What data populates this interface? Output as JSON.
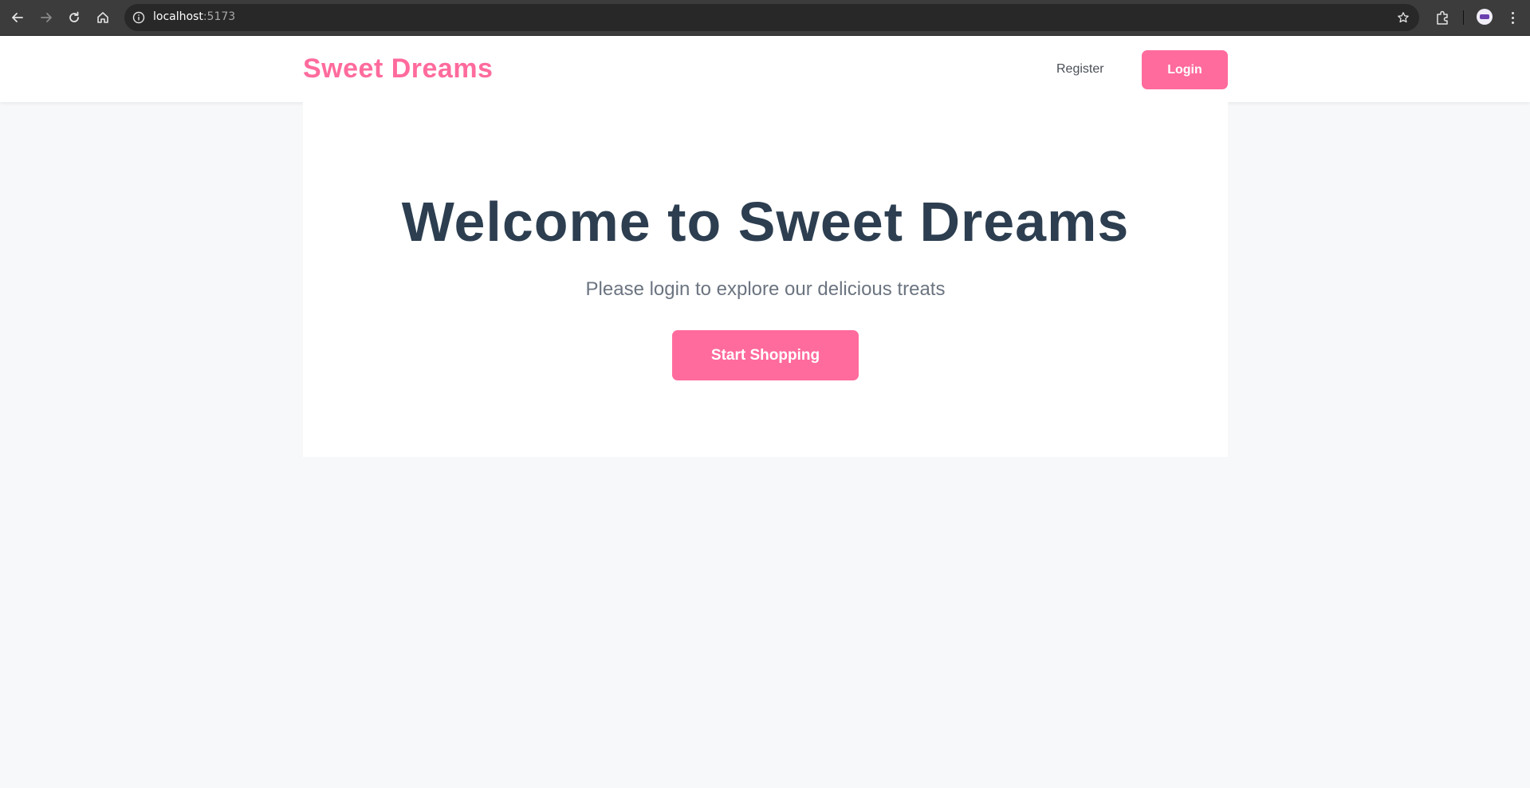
{
  "browser": {
    "url_host": "localhost",
    "url_port": ":5173"
  },
  "header": {
    "logo": "Sweet Dreams",
    "register_label": "Register",
    "login_label": "Login"
  },
  "hero": {
    "title": "Welcome to Sweet Dreams",
    "subtitle": "Please login to explore our delicious treats",
    "cta_label": "Start Shopping"
  },
  "colors": {
    "brand_pink": "#ff6b9d",
    "heading": "#2c3e50",
    "page_bg": "#f7f8fa"
  },
  "icons": [
    "back-arrow-icon",
    "forward-arrow-icon",
    "reload-icon",
    "home-icon",
    "site-info-icon",
    "bookmark-star-icon",
    "extensions-icon",
    "profile-avatar",
    "more-menu-icon"
  ]
}
